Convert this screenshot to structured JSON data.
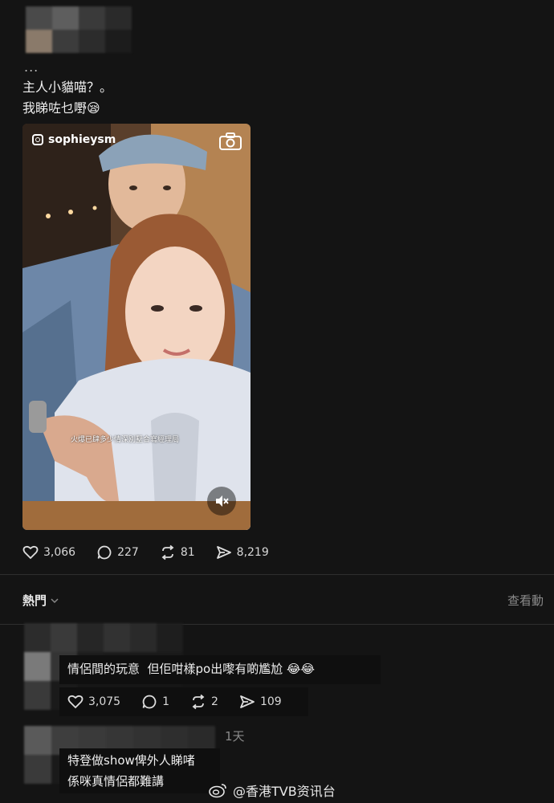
{
  "post": {
    "ellipsis": "...",
    "line1": "主人小貓喵？。",
    "line2": "我睇咗乜嘢😪",
    "media": {
      "handle": "sophieysm",
      "overlay_caption": "火爆已肆多少情深別墅合寫經理局"
    },
    "stats": {
      "likes": "3,066",
      "comments": "227",
      "reposts": "81",
      "shares": "8,219"
    }
  },
  "section": {
    "label": "熱門",
    "view_more": "查看動"
  },
  "comments": [
    {
      "text": "情侶間的玩意  但佢咁樣po出嚟有啲尷尬 😂😂",
      "likes": "3,075",
      "replies": "1",
      "reposts": "2",
      "shares": "109"
    },
    {
      "time": "1天",
      "line1": "特登做show俾外人睇啫",
      "line2": "係咪真情侶都難講"
    }
  ],
  "watermark": {
    "text": "@香港TVB资讯台"
  },
  "colors": {
    "background": "#141414",
    "text": "#f0f0f0",
    "muted": "#8a8a8a"
  }
}
